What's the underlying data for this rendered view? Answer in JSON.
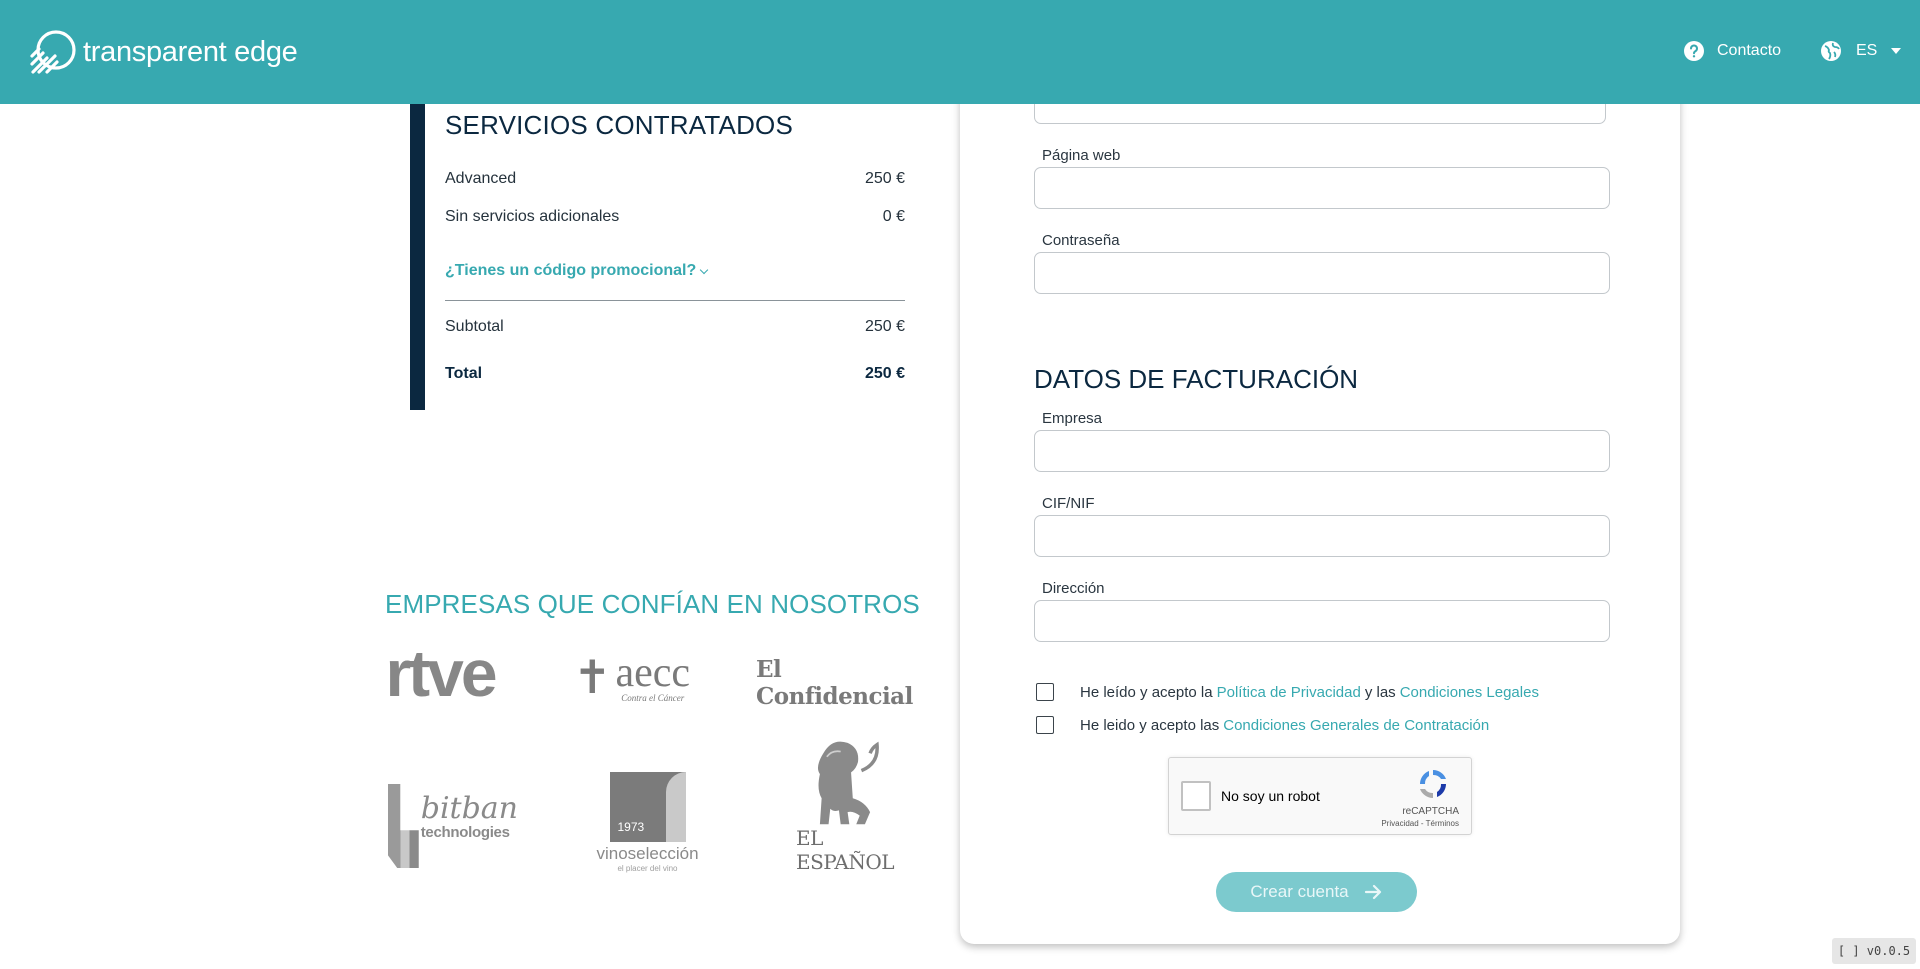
{
  "header": {
    "brand": "transparent edge",
    "contact_label": "Contacto",
    "language": "ES",
    "background": "#37a9b0"
  },
  "summary": {
    "title": "SERVICIOS CONTRATADOS",
    "lines": [
      {
        "label": "Advanced",
        "price": "250 €"
      },
      {
        "label": "Sin servicios adicionales",
        "price": "0 €"
      }
    ],
    "promo_label": "¿Tienes un código promocional?",
    "subtotal_label": "Subtotal",
    "subtotal_value": "250 €",
    "total_label": "Total",
    "total_value": "250 €",
    "accent": "#0b2840"
  },
  "companies": {
    "title": "EMPRESAS QUE CONFÍAN EN NOSOTROS",
    "logos": {
      "rtve": "rtve",
      "aecc": "aecc",
      "aecc_sub": "Contra el Cáncer",
      "elconfidencial": "El Confidencial",
      "bitban": "bitban",
      "bitban_sub": "technologies",
      "vino_year": "1973",
      "vino": "vinoselección",
      "vino_sub": "el placer del vino",
      "espanol": "EL ESPAÑOL"
    }
  },
  "form": {
    "website_label": "Página web",
    "password_label": "Contraseña",
    "billing_title": "DATOS DE FACTURACIÓN",
    "company_label": "Empresa",
    "cif_label": "CIF/NIF",
    "address_label": "Dirección",
    "privacy": {
      "prefix": "He leído y acepto la",
      "link1": "Política de Privacidad",
      "middle": "y las",
      "link2": "Condiciones Legales"
    },
    "terms": {
      "prefix": "He leido y acepto las",
      "link": "Condiciones Generales de Contratación"
    },
    "captcha": {
      "label": "No soy un robot",
      "brand": "reCAPTCHA",
      "links": "Privacidad - Términos"
    },
    "submit_label": "Crear cuenta"
  },
  "version": "[ ] v0.0.5"
}
